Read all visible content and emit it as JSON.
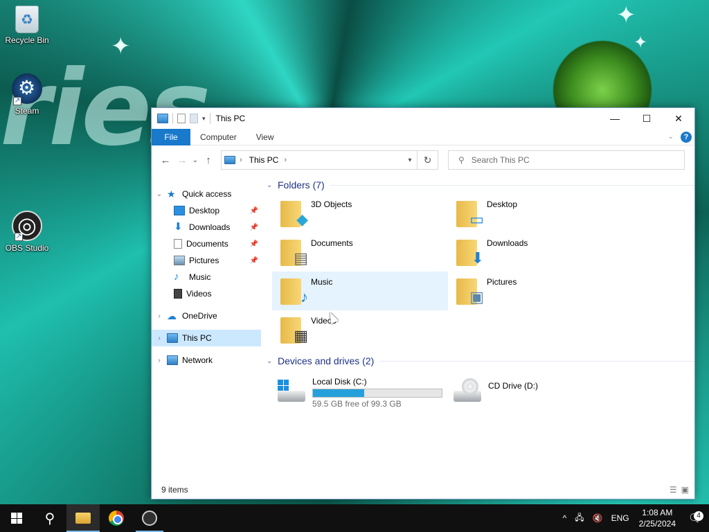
{
  "desktop": {
    "icons": [
      {
        "label": "Recycle Bin"
      },
      {
        "label": "Steam"
      },
      {
        "label": "OBS Studio"
      }
    ],
    "wallpaper_text": "ries"
  },
  "window": {
    "title": "This PC",
    "controls": {
      "minimize": "—",
      "maximize": "☐",
      "close": "✕"
    },
    "ribbon": {
      "tabs": [
        "File",
        "Computer",
        "View"
      ],
      "help": "?"
    },
    "navbar": {
      "back": "←",
      "forward": "→",
      "recent": "⌄",
      "up": "↑",
      "address": "This PC",
      "refresh": "↻",
      "search_placeholder": "Search This PC"
    },
    "sidebar": {
      "quick_access": "Quick access",
      "quick_items": [
        {
          "label": "Desktop",
          "pinned": true
        },
        {
          "label": "Downloads",
          "pinned": true
        },
        {
          "label": "Documents",
          "pinned": true
        },
        {
          "label": "Pictures",
          "pinned": true
        },
        {
          "label": "Music",
          "pinned": false
        },
        {
          "label": "Videos",
          "pinned": false
        }
      ],
      "onedrive": "OneDrive",
      "this_pc": "This PC",
      "network": "Network"
    },
    "folders_header": "Folders (7)",
    "folders": [
      {
        "name": "3D Objects",
        "icon": "cube-icon"
      },
      {
        "name": "Desktop",
        "icon": "monitor-icon"
      },
      {
        "name": "Documents",
        "icon": "document-icon"
      },
      {
        "name": "Downloads",
        "icon": "download-arrow-icon"
      },
      {
        "name": "Music",
        "icon": "music-note-icon"
      },
      {
        "name": "Pictures",
        "icon": "picture-icon"
      },
      {
        "name": "Videos",
        "icon": "film-icon"
      }
    ],
    "devices_header": "Devices and drives (2)",
    "drives": [
      {
        "name": "Local Disk (C:)",
        "free_text": "59.5 GB free of 99.3 GB",
        "used_fraction": 0.4
      },
      {
        "name": "CD Drive (D:)"
      }
    ],
    "status": "9 items"
  },
  "taskbar": {
    "tray_lang": "ENG",
    "time": "1:08 AM",
    "date": "2/25/2024",
    "notification_count": "4"
  }
}
